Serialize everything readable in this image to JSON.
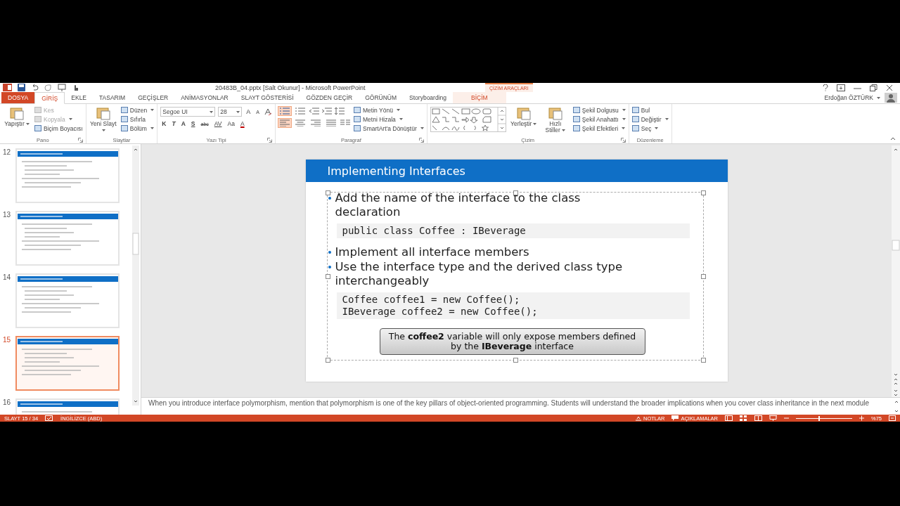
{
  "window": {
    "title": "20483B_04.pptx [Salt Okunur] - Microsoft PowerPoint",
    "contextual_label": "ÇİZİM ARAÇLARI",
    "user": "Erdoğan ÖZTÜRK"
  },
  "tabs": [
    {
      "label": "DOSYA",
      "kind": "file",
      "selected": false
    },
    {
      "label": "GİRİŞ",
      "kind": "normal",
      "selected": true
    },
    {
      "label": "EKLE",
      "kind": "normal",
      "selected": false
    },
    {
      "label": "TASARIM",
      "kind": "normal",
      "selected": false
    },
    {
      "label": "GEÇİŞLER",
      "kind": "normal",
      "selected": false
    },
    {
      "label": "ANİMASYONLAR",
      "kind": "normal",
      "selected": false
    },
    {
      "label": "SLAYT GÖSTERİSİ",
      "kind": "normal",
      "selected": false
    },
    {
      "label": "GÖZDEN GEÇİR",
      "kind": "normal",
      "selected": false
    },
    {
      "label": "GÖRÜNÜM",
      "kind": "normal",
      "selected": false
    },
    {
      "label": "Storyboarding",
      "kind": "normal",
      "selected": false
    },
    {
      "label": "BİÇİM",
      "kind": "contextual",
      "selected": false
    }
  ],
  "ribbon": [
    {
      "label": "Pano",
      "launcher": true,
      "items": [
        {
          "kind": "large",
          "label": "Yapıştır",
          "dropdown": true
        },
        {
          "kind": "stack",
          "items": [
            {
              "label": "Kes",
              "dropdown": false,
              "disabled": true
            },
            {
              "label": "Kopyala",
              "dropdown": true,
              "disabled": true
            },
            {
              "label": "Biçim Boyacısı",
              "dropdown": false,
              "disabled": false
            }
          ]
        }
      ]
    },
    {
      "label": "Slaytlar",
      "launcher": false,
      "items": [
        {
          "kind": "large",
          "label": "Yeni Slayt",
          "dropdown": true
        },
        {
          "kind": "stack",
          "items": [
            {
              "label": "Düzen",
              "dropdown": true,
              "disabled": false
            },
            {
              "label": "Sıfırla",
              "dropdown": false,
              "disabled": false
            },
            {
              "label": "Bölüm",
              "dropdown": true,
              "disabled": false
            }
          ]
        }
      ]
    },
    {
      "label": "Yazı Tipi",
      "launcher": true,
      "items": [
        {
          "kind": "font",
          "font": "Segoe UI",
          "size": "28",
          "grow_buttons": [
            "A",
            "A"
          ],
          "format_buttons": [
            "K",
            "T",
            "A",
            "S",
            "abc",
            "AV",
            "Aa",
            "A"
          ]
        }
      ]
    },
    {
      "label": "Paragraf",
      "launcher": true,
      "items": [
        {
          "kind": "paragraph",
          "list_buttons": [
            {
              "selected": true
            },
            {
              "selected": false
            }
          ],
          "align_buttons": [
            {
              "selected": true
            },
            {
              "selected": false
            },
            {
              "selected": false
            },
            {
              "selected": false
            }
          ]
        },
        {
          "kind": "stack",
          "items": [
            {
              "label": "Metin Yönü",
              "dropdown": true,
              "disabled": false
            },
            {
              "label": "Metni Hizala",
              "dropdown": true,
              "disabled": false
            },
            {
              "label": "SmartArt'a Dönüştür",
              "dropdown": true,
              "disabled": false
            }
          ]
        }
      ]
    },
    {
      "label": "Çizim",
      "launcher": true,
      "items": [
        {
          "kind": "gallery"
        },
        {
          "kind": "large",
          "label": "Yerleştir",
          "dropdown": true
        },
        {
          "kind": "large",
          "label": "Hızlı Stiller",
          "dropdown": true
        },
        {
          "kind": "stack",
          "items": [
            {
              "label": "Şekil Dolgusu",
              "dropdown": true,
              "disabled": false
            },
            {
              "label": "Şekil Anahattı",
              "dropdown": true,
              "disabled": false
            },
            {
              "label": "Şekil Efektleri",
              "dropdown": true,
              "disabled": false
            }
          ]
        }
      ]
    },
    {
      "label": "Düzenleme",
      "launcher": false,
      "items": [
        {
          "kind": "stack",
          "items": [
            {
              "label": "Bul",
              "dropdown": false,
              "disabled": false
            },
            {
              "label": "Değiştir",
              "dropdown": true,
              "disabled": false
            },
            {
              "label": "Seç",
              "dropdown": true,
              "disabled": false
            }
          ]
        }
      ]
    }
  ],
  "thumbnails": [
    {
      "number": "12",
      "selected": false
    },
    {
      "number": "13",
      "selected": false
    },
    {
      "number": "14",
      "selected": false
    },
    {
      "number": "15",
      "selected": true
    },
    {
      "number": "16",
      "selected": false
    }
  ],
  "slide": {
    "title": "Implementing Interfaces",
    "body": [
      {
        "kind": "bullet",
        "text": "Add the name of the interface to the class declaration"
      },
      {
        "kind": "code",
        "lines": [
          "public class Coffee : IBeverage"
        ]
      },
      {
        "kind": "bullet",
        "text": "Implement all interface members"
      },
      {
        "kind": "bullet",
        "text": "Use the interface type and the derived class type interchangeably"
      },
      {
        "kind": "code",
        "lines": [
          "Coffee coffee1 = new Coffee();",
          "IBeverage coffee2 = new Coffee();"
        ]
      }
    ],
    "callout": "The **coffee2** variable will only expose members defined by the **IBeverage** interface"
  },
  "notes": "When you introduce interface polymorphism, mention that polymorphism is one of the key pillars of object-oriented programming. Students will understand the broader implications when you cover class inheritance in the next module",
  "status_bar": {
    "slide_indicator": "SLAYT 15 / 34",
    "language": "İNGİLİZCE (ABD)",
    "notes_button": "NOTLAR",
    "comments_button": "AÇIKLAMALAR",
    "zoom": "%75",
    "zoom_slider": {
      "level": 0.4
    }
  }
}
